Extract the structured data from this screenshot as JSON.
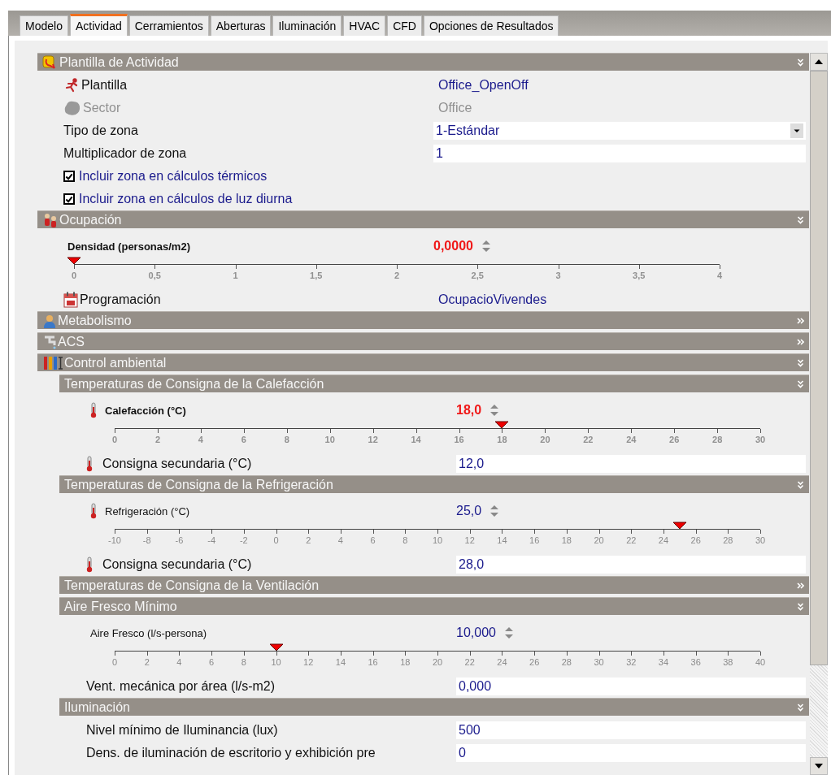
{
  "tabs": [
    {
      "label": "Modelo",
      "selected": false
    },
    {
      "label": "Actividad",
      "selected": true
    },
    {
      "label": "Cerramientos",
      "selected": false
    },
    {
      "label": "Aberturas",
      "selected": false
    },
    {
      "label": "Iluminación",
      "selected": false
    },
    {
      "label": "HVAC",
      "selected": false
    },
    {
      "label": "CFD",
      "selected": false
    },
    {
      "label": "Opciones de Resultados",
      "selected": false
    }
  ],
  "sections": [
    {
      "title": "Plantilla de Actividad",
      "expanded": true,
      "rows": [
        {
          "kind": "value",
          "label": "Plantilla",
          "value": "Office_OpenOff",
          "disabled": false
        },
        {
          "kind": "value",
          "label": "Sector",
          "value": "Office",
          "disabled": true
        },
        {
          "kind": "select",
          "label": "Tipo de zona",
          "value": "1-Estándar"
        },
        {
          "kind": "input",
          "label": "Multiplicador de zona",
          "value": "1"
        },
        {
          "kind": "checkbox",
          "label": "Incluir zona en cálculos térmicos",
          "checked": true
        },
        {
          "kind": "checkbox",
          "label": "Incluir zona en cálculos de luz diurna",
          "checked": true
        }
      ]
    },
    {
      "title": "Ocupación",
      "expanded": true,
      "rows": [
        {
          "kind": "slider",
          "label": "Densidad (personas/m2)",
          "reading": "0,0000",
          "highlighted": true,
          "level": 0,
          "ticks": [
            "0",
            "0,5",
            "1",
            "1,5",
            "2",
            "2,5",
            "3",
            "3,5",
            "4"
          ]
        },
        {
          "kind": "value",
          "label": "Programación",
          "value": "OcupacioVivendes",
          "disabled": false
        }
      ]
    },
    {
      "title": "Metabolismo",
      "expanded": false
    },
    {
      "title": "ACS",
      "expanded": false
    },
    {
      "title": "Control ambiental",
      "expanded": true,
      "children": [
        {
          "title": "Temperaturas de Consigna de la Calefacción",
          "expanded": true,
          "rows": [
            {
              "kind": "slider",
              "label": "Calefacción (°C)",
              "reading": "18,0",
              "highlighted": true,
              "level": 0.6,
              "ticks": [
                "0",
                "2",
                "4",
                "6",
                "8",
                "10",
                "12",
                "14",
                "16",
                "18",
                "20",
                "22",
                "24",
                "26",
                "28",
                "30"
              ]
            },
            {
              "kind": "input",
              "label": "Consigna secundaria (°C)",
              "value": "12,0"
            }
          ]
        },
        {
          "title": "Temperaturas de Consigna de la Refrigeración",
          "expanded": true,
          "rows": [
            {
              "kind": "slider",
              "label": "Refrigeración (°C)",
              "reading": "25,0",
              "highlighted": false,
              "level": 0.875,
              "ticks": [
                "-10",
                "-8",
                "-6",
                "-4",
                "-2",
                "0",
                "2",
                "4",
                "6",
                "8",
                "10",
                "12",
                "14",
                "16",
                "18",
                "20",
                "22",
                "24",
                "26",
                "28",
                "30"
              ]
            },
            {
              "kind": "input",
              "label": "Consigna secundaria (°C)",
              "value": "28,0"
            }
          ]
        },
        {
          "title": "Temperaturas de Consigna de la Ventilación",
          "expanded": false
        },
        {
          "title": "Aire Fresco Mínimo",
          "expanded": true,
          "rows": [
            {
              "kind": "slider",
              "label": "Aire Fresco (l/s-persona)",
              "reading": "10,000",
              "highlighted": false,
              "level": 0.25,
              "ticks": [
                "0",
                "2",
                "4",
                "6",
                "8",
                "10",
                "12",
                "14",
                "16",
                "18",
                "20",
                "22",
                "24",
                "26",
                "28",
                "30",
                "32",
                "34",
                "36",
                "38",
                "40"
              ]
            },
            {
              "kind": "input",
              "label": "Vent. mecánica por área (l/s-m2)",
              "value": "0,000"
            }
          ]
        },
        {
          "title": "Iluminación",
          "expanded": true,
          "rows": [
            {
              "kind": "input",
              "label": "Nivel mínimo de Iluminancia (lux)",
              "value": "500"
            },
            {
              "kind": "input",
              "label": "Dens. de iluminación de escritorio y exhibición pre",
              "value": "0"
            }
          ]
        }
      ]
    }
  ]
}
